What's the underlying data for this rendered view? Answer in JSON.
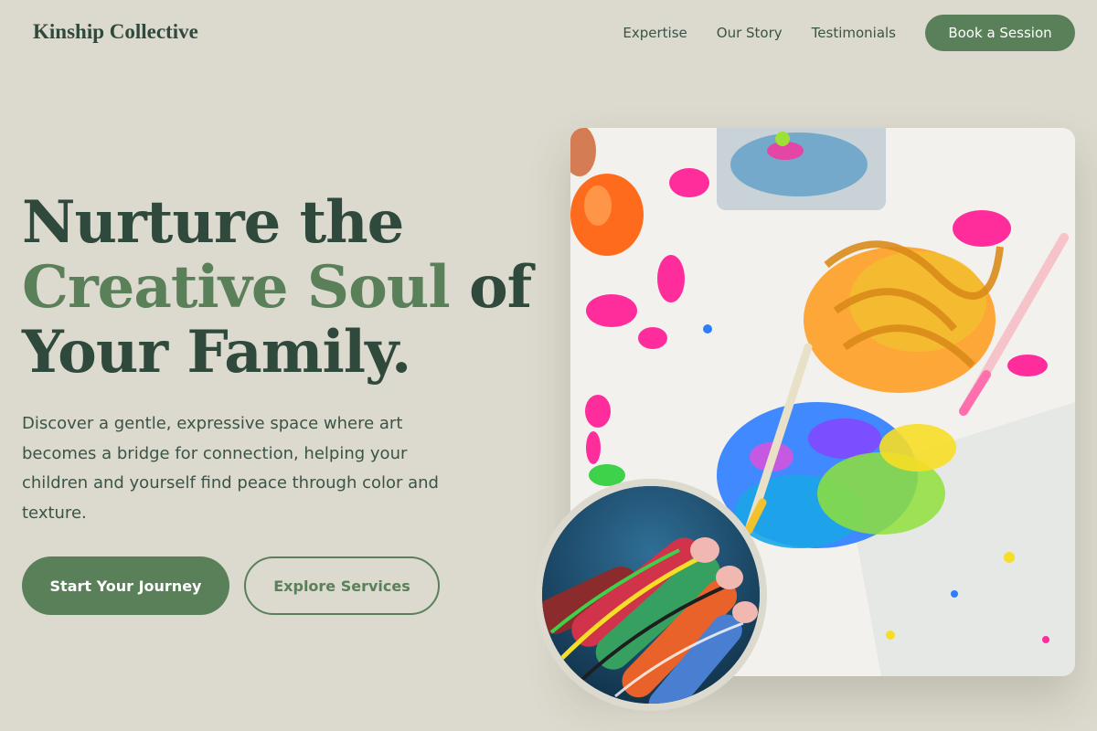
{
  "brand": {
    "name": "Kinship Collective"
  },
  "nav": {
    "links": [
      "Expertise",
      "Our Story",
      "Testimonials"
    ],
    "cta": "Book a Session"
  },
  "hero": {
    "headline_part1": "Nurture the",
    "headline_accent": "Creative Soul",
    "headline_part2": " of",
    "headline_part3": "Your Family.",
    "lede": "Discover a gentle, expressive space where art becomes a bridge for connection, helping your children and yourself find peace through color and texture.",
    "primary_button": "Start Your Journey",
    "secondary_button": "Explore Services"
  },
  "images": {
    "main": "paint-splatter-artwork",
    "circle": "painted-hand"
  },
  "colors": {
    "background": "#dcd9ce",
    "primary": "#5a8059",
    "text_dark": "#2f4a3c"
  }
}
